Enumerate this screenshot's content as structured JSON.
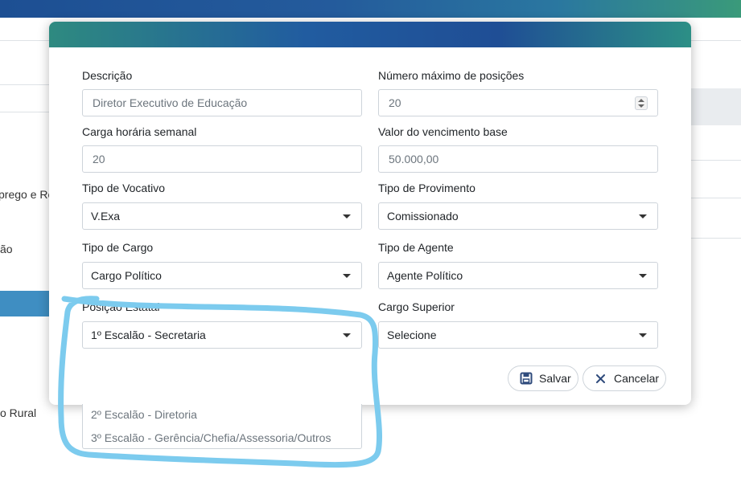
{
  "background": {
    "left_texts": [
      "prego e Re",
      "ão",
      "o Rural"
    ]
  },
  "modal": {
    "fields": {
      "descricao": {
        "label": "Descrição",
        "value": "Diretor Executivo de Educação"
      },
      "numero_maximo": {
        "label": "Número máximo de posições",
        "value": "20"
      },
      "carga_horaria": {
        "label": "Carga horária semanal",
        "value": "20"
      },
      "valor_vencimento": {
        "label": "Valor do vencimento base",
        "value": "50.000,00"
      },
      "tipo_vocativo": {
        "label": "Tipo de Vocativo",
        "value": "V.Exa"
      },
      "tipo_provimento": {
        "label": "Tipo de Provimento",
        "value": "Comissionado"
      },
      "tipo_cargo": {
        "label": "Tipo de Cargo",
        "value": "Cargo Político"
      },
      "tipo_agente": {
        "label": "Tipo de Agente",
        "value": "Agente Político"
      },
      "posicao_estatal": {
        "label": "Posição Estatal",
        "value": "1º Escalão - Secretaria"
      },
      "cargo_superior": {
        "label": "Cargo Superior",
        "value": "Selecione"
      }
    },
    "buttons": {
      "save": "Salvar",
      "cancel": "Cancelar"
    }
  },
  "dropdown_options": [
    "2º Escalão - Diretoria",
    "3º Escalão - Gerência/Chefia/Assessoria/Outros"
  ],
  "colors": {
    "header_gradient_start": "#1d4f93",
    "header_gradient_end": "#3a9a7a",
    "annotation_stroke": "#7ccbee",
    "cancel_icon": "#2f4b7c"
  }
}
